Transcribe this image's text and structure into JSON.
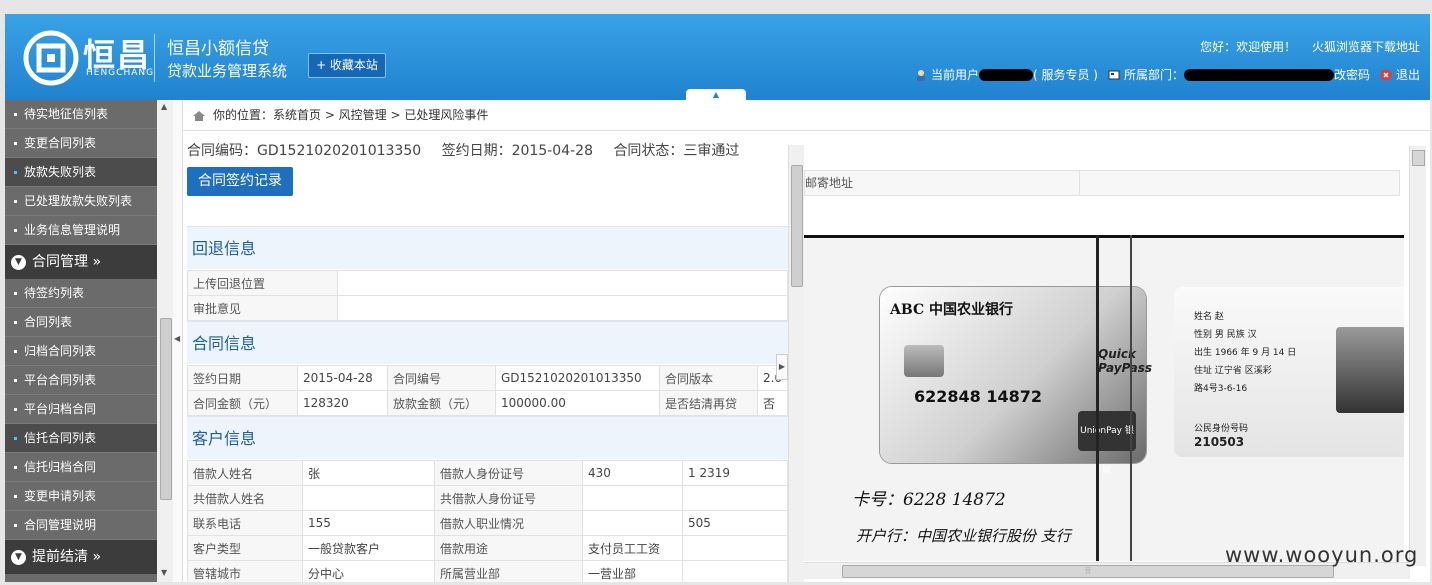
{
  "header": {
    "logo_text": "恒昌",
    "logo_sub": "HENGCHANG",
    "system_title_1": "恒昌小额信贷",
    "system_title_2": "贷款业务管理系统",
    "favorite_button": "+ 收藏本站",
    "greeting": "您好：欢迎使用！",
    "browser_link": "火狐浏览器下载地址",
    "current_user_label": "当前用户",
    "user_role": "( 服务专员 )",
    "department_label": "所属部门：",
    "change_password": "改密码",
    "logout": "退出",
    "toggle_arrow": "▲"
  },
  "sidebar": {
    "items_top": [
      {
        "label": "待实地征信列表",
        "active": false
      },
      {
        "label": "变更合同列表",
        "active": false
      },
      {
        "label": "放款失败列表",
        "active": true
      },
      {
        "label": "已处理放款失败列表",
        "active": false
      },
      {
        "label": "业务信息管理说明",
        "active": false
      }
    ],
    "group_contract": "合同管理 »",
    "items_contract": [
      {
        "label": "待签约列表",
        "active": false
      },
      {
        "label": "合同列表",
        "active": false
      },
      {
        "label": "归档合同列表",
        "active": false
      },
      {
        "label": "平台合同列表",
        "active": false
      },
      {
        "label": "平台归档合同",
        "active": false
      },
      {
        "label": "信托合同列表",
        "active": true
      },
      {
        "label": "信托归档合同",
        "active": false
      },
      {
        "label": "变更申请列表",
        "active": false
      },
      {
        "label": "合同管理说明",
        "active": false
      }
    ],
    "group_early": "提前结清 »"
  },
  "breadcrumb": {
    "text": "你的位置：系统首页 > 风控管理 > 已处理风险事件"
  },
  "contract_meta": {
    "code": "合同编码：GD1521020201013350",
    "sign_date": "签约日期：2015-04-28",
    "status": "合同状态：三审通过"
  },
  "sign_record_button": "合同签约记录",
  "return_section": {
    "title": "回退信息",
    "rows": [
      [
        "上传回退位置",
        ""
      ],
      [
        "审批意见",
        ""
      ]
    ]
  },
  "contract_section": {
    "title": "合同信息",
    "rows": [
      [
        "签约日期",
        "2015-04-28",
        "合同编号",
        "GD1521020201013350",
        "合同版本",
        "2.0"
      ],
      [
        "合同金额（元）",
        "128320",
        "放款金额（元）",
        "100000.00",
        "是否结清再贷",
        "否"
      ]
    ]
  },
  "customer_section": {
    "title": "客户信息",
    "rows": [
      [
        "借款人姓名",
        "张",
        "借款人身份证号",
        "430",
        "1 2319"
      ],
      [
        "共借款人姓名",
        "",
        "共借款人身份证号",
        "",
        ""
      ],
      [
        "联系电话",
        "155",
        "借款人职业情况",
        "",
        "505"
      ],
      [
        "客户类型",
        "一般贷款客户",
        "借款用途",
        "支付员工工资",
        ""
      ],
      [
        "管辖城市",
        "分中心",
        "所属营业部",
        "一营业部",
        ""
      ]
    ]
  },
  "right_pane": {
    "mail_address_label": "邮寄地址",
    "bank_name": "ABC 中国农业银行",
    "quickpass": "Quick PayPass",
    "card_number": "622848        14872",
    "unionpay": "UnionPay 银联",
    "id_fields": [
      "姓名  赵",
      "性别  男    民族  汉",
      "出生  1966 年  9 月 14 日",
      "住址  辽宁省         区溪彩",
      "       路4号3-6-16"
    ],
    "id_label": "公民身份号码",
    "id_number": "210503",
    "handwriting_1": "卡号：6228       14872",
    "handwriting_2": "开户行：中国农业银行股份        支行"
  },
  "watermark": "www.wooyun.org"
}
